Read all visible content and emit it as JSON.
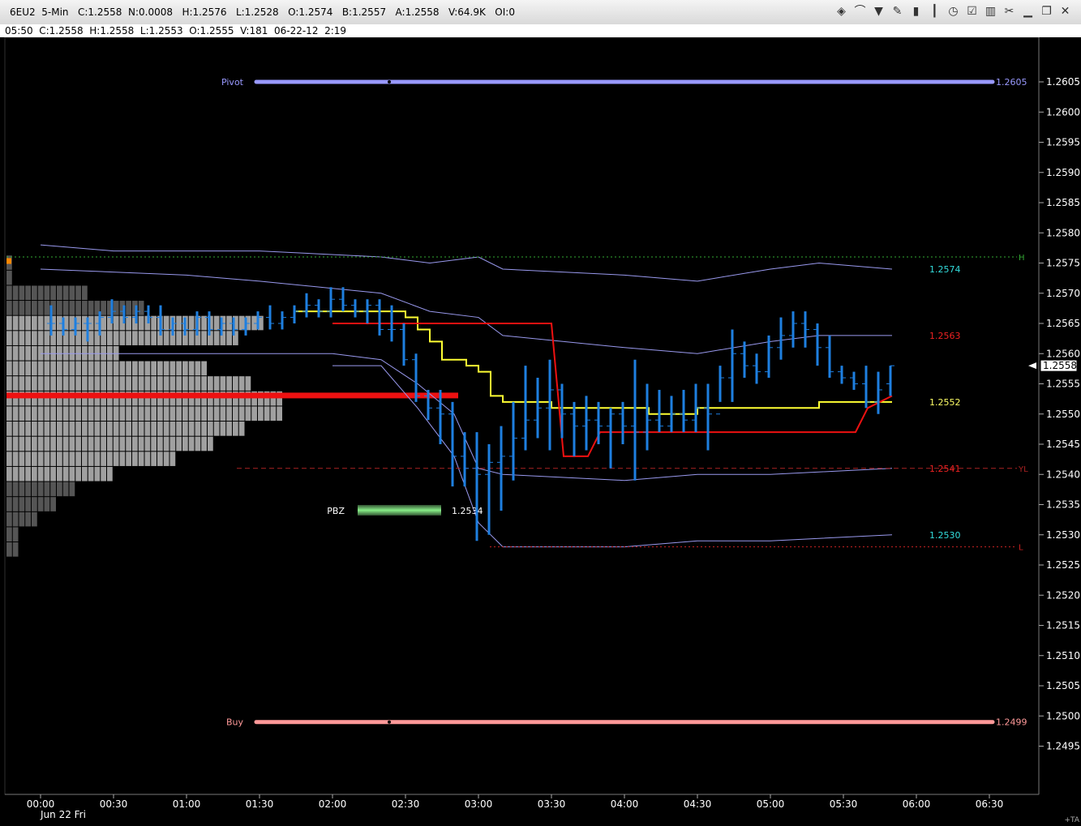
{
  "window": {
    "title": "6EU2  5-Min   C:1.2558  N:0.0008   H:1.2576   L:1.2528   O:1.2574   B:1.2557   A:1.2558   V:64.9K   OI:0",
    "info": "05:50  C:1.2558  H:1.2558  L:1.2553  O:1.2555  V:181  06-22-12  2:19",
    "toolbar": [
      "layers-icon",
      "rainbow-icon",
      "funnel-icon",
      "pencil-icon",
      "bars-icon",
      "candle-icon",
      "clock-icon",
      "checklist-icon",
      "trash-icon",
      "tool-icon",
      "minimize-icon",
      "restore-icon",
      "close-icon"
    ],
    "corner_label": "+TA"
  },
  "chart_data": {
    "type": "bar",
    "price_axis": {
      "range": [
        1.2491,
        1.2615
      ],
      "ticks": [
        "1.2605",
        "1.2600",
        "1.2595",
        "1.2590",
        "1.2585",
        "1.2580",
        "1.2575",
        "1.2570",
        "1.2565",
        "1.2560",
        "1.2555",
        "1.2550",
        "1.2545",
        "1.2540",
        "1.2535",
        "1.2530",
        "1.2525",
        "1.2520",
        "1.2515",
        "1.2510",
        "1.2505",
        "1.2500",
        "1.2495"
      ],
      "last_price_label": "1.2558",
      "last_price": 1.2558
    },
    "time_axis": {
      "ticks": [
        "00:00",
        "00:30",
        "01:00",
        "01:30",
        "02:00",
        "02:30",
        "03:00",
        "03:30",
        "04:00",
        "04:30",
        "05:00",
        "05:30",
        "06:00",
        "06:30"
      ],
      "date_label": "Jun 22 Fri"
    },
    "colors": {
      "bars": "#1e7fe0",
      "yellow": "#ffff33",
      "red": "#ee1111",
      "blue_bands": "#9999ee",
      "pivot": "#9999ff",
      "buy": "#ff9999",
      "profile_light": "#a0a0a0",
      "profile_dark": "#555555",
      "poc": "#ee1111",
      "pbz": "#88ee88"
    },
    "levels": [
      {
        "label": "Pivot",
        "value": 1.2605,
        "value_label": "1.2605",
        "style": "thick",
        "color": "#9999ff",
        "name_color": "#9999ff"
      },
      {
        "label": "Buy",
        "value": 1.2499,
        "value_label": "1.2499",
        "style": "thick",
        "color": "#ff9999",
        "name_color": "#ff9999"
      },
      {
        "label": "H",
        "value": 1.2576,
        "style": "dotted",
        "color": "#33aa33"
      },
      {
        "label": "YL",
        "value": 1.2541,
        "style": "dashed",
        "color": "#aa2222"
      },
      {
        "label": "L",
        "value": 1.2528,
        "style": "dotted",
        "color": "#cc2222"
      }
    ],
    "right_labels": [
      {
        "value": 1.2574,
        "text": "1.2574",
        "color": "#33dddd"
      },
      {
        "value": 1.2563,
        "text": "1.2563",
        "color": "#ee2222"
      },
      {
        "value": 1.2552,
        "text": "1.2552",
        "color": "#ffff66"
      },
      {
        "value": 1.2541,
        "text": "1.2541",
        "color": "#ee2222"
      },
      {
        "value": 1.253,
        "text": "1.2530",
        "color": "#33dddd"
      }
    ],
    "pbz": {
      "label": "PBZ",
      "value": 1.2534,
      "value_label": "1.2534"
    },
    "poc_price": 1.2553,
    "ohlc_bars": [
      [
        "00:05",
        1.2565,
        1.2568,
        1.2563,
        1.2565
      ],
      [
        "00:10",
        1.2565,
        1.2566,
        1.2563,
        1.2564
      ],
      [
        "00:15",
        1.2564,
        1.2566,
        1.2563,
        1.2565
      ],
      [
        "00:20",
        1.2565,
        1.2566,
        1.2562,
        1.2565
      ],
      [
        "00:25",
        1.2565,
        1.2567,
        1.2563,
        1.2566
      ],
      [
        "00:30",
        1.2566,
        1.2569,
        1.2565,
        1.2567
      ],
      [
        "00:35",
        1.2567,
        1.2568,
        1.2565,
        1.2566
      ],
      [
        "00:40",
        1.2566,
        1.2568,
        1.2565,
        1.2567
      ],
      [
        "00:45",
        1.2567,
        1.2568,
        1.2565,
        1.2566
      ],
      [
        "00:50",
        1.2566,
        1.2568,
        1.2563,
        1.2564
      ],
      [
        "00:55",
        1.2564,
        1.2566,
        1.2563,
        1.2565
      ],
      [
        "01:00",
        1.2565,
        1.2566,
        1.2563,
        1.2564
      ],
      [
        "01:05",
        1.2564,
        1.2567,
        1.2563,
        1.2566
      ],
      [
        "01:10",
        1.2566,
        1.2567,
        1.2563,
        1.2564
      ],
      [
        "01:15",
        1.2564,
        1.2566,
        1.2563,
        1.2565
      ],
      [
        "01:20",
        1.2565,
        1.2566,
        1.2563,
        1.2564
      ],
      [
        "01:25",
        1.2564,
        1.2566,
        1.2563,
        1.2565
      ],
      [
        "01:30",
        1.2565,
        1.2567,
        1.2564,
        1.2566
      ],
      [
        "01:35",
        1.2566,
        1.2568,
        1.2564,
        1.2565
      ],
      [
        "01:40",
        1.2565,
        1.2567,
        1.2564,
        1.2566
      ],
      [
        "01:45",
        1.2566,
        1.2568,
        1.2565,
        1.2567
      ],
      [
        "01:50",
        1.2567,
        1.257,
        1.2566,
        1.2568
      ],
      [
        "01:55",
        1.2568,
        1.2569,
        1.2566,
        1.2567
      ],
      [
        "02:00",
        1.2567,
        1.2571,
        1.2566,
        1.2569
      ],
      [
        "02:05",
        1.2569,
        1.2571,
        1.2567,
        1.2568
      ],
      [
        "02:10",
        1.2568,
        1.2569,
        1.2566,
        1.2567
      ],
      [
        "02:15",
        1.2567,
        1.2569,
        1.2565,
        1.2568
      ],
      [
        "02:20",
        1.2568,
        1.2569,
        1.2563,
        1.2564
      ],
      [
        "02:25",
        1.2564,
        1.2568,
        1.2562,
        1.2564
      ],
      [
        "02:30",
        1.2564,
        1.2565,
        1.2558,
        1.2559
      ],
      [
        "02:35",
        1.2559,
        1.256,
        1.2552,
        1.2553
      ],
      [
        "02:40",
        1.2553,
        1.2554,
        1.2549,
        1.2551
      ],
      [
        "02:45",
        1.2551,
        1.2554,
        1.2545,
        1.255
      ],
      [
        "02:50",
        1.255,
        1.2552,
        1.2538,
        1.2543
      ],
      [
        "02:55",
        1.2543,
        1.2547,
        1.2538,
        1.2541
      ],
      [
        "03:00",
        1.2541,
        1.2547,
        1.2529,
        1.254
      ],
      [
        "03:05",
        1.254,
        1.2545,
        1.253,
        1.2542
      ],
      [
        "03:10",
        1.2542,
        1.2548,
        1.2534,
        1.2543
      ],
      [
        "03:15",
        1.2543,
        1.2552,
        1.2539,
        1.2546
      ],
      [
        "03:20",
        1.2546,
        1.2558,
        1.2544,
        1.2549
      ],
      [
        "03:25",
        1.2549,
        1.2556,
        1.2546,
        1.2551
      ],
      [
        "03:30",
        1.2551,
        1.2559,
        1.2544,
        1.2554
      ],
      [
        "03:35",
        1.2554,
        1.2555,
        1.2546,
        1.255
      ],
      [
        "03:40",
        1.255,
        1.2552,
        1.2543,
        1.2548
      ],
      [
        "03:45",
        1.2548,
        1.2553,
        1.2544,
        1.2549
      ],
      [
        "03:50",
        1.2549,
        1.2552,
        1.2545,
        1.2548
      ],
      [
        "03:55",
        1.2548,
        1.2551,
        1.2541,
        1.255
      ],
      [
        "04:00",
        1.255,
        1.2552,
        1.2545,
        1.2548
      ],
      [
        "04:05",
        1.2548,
        1.2559,
        1.2539,
        1.2547
      ],
      [
        "04:10",
        1.2547,
        1.2555,
        1.2544,
        1.2549
      ],
      [
        "04:15",
        1.2549,
        1.2554,
        1.2547,
        1.2548
      ],
      [
        "04:20",
        1.2548,
        1.2553,
        1.2547,
        1.255
      ],
      [
        "04:25",
        1.255,
        1.2554,
        1.2547,
        1.2549
      ],
      [
        "04:30",
        1.2549,
        1.2555,
        1.2547,
        1.2551
      ],
      [
        "04:35",
        1.2551,
        1.2555,
        1.2544,
        1.255
      ],
      [
        "04:40",
        1.255,
        1.2558,
        1.2552,
        1.2556
      ],
      [
        "04:45",
        1.2556,
        1.2564,
        1.2552,
        1.256
      ],
      [
        "04:50",
        1.256,
        1.2562,
        1.2556,
        1.2558
      ],
      [
        "04:55",
        1.2558,
        1.256,
        1.2555,
        1.2557
      ],
      [
        "05:00",
        1.2557,
        1.2563,
        1.2556,
        1.2561
      ],
      [
        "05:05",
        1.2561,
        1.2566,
        1.2559,
        1.2563
      ],
      [
        "05:10",
        1.2563,
        1.2567,
        1.2561,
        1.2565
      ],
      [
        "05:15",
        1.2565,
        1.2567,
        1.2561,
        1.2564
      ],
      [
        "05:20",
        1.2564,
        1.2565,
        1.2558,
        1.2561
      ],
      [
        "05:25",
        1.2561,
        1.2563,
        1.2556,
        1.2557
      ],
      [
        "05:30",
        1.2557,
        1.2558,
        1.2555,
        1.2556
      ],
      [
        "05:35",
        1.2556,
        1.2557,
        1.2554,
        1.2555
      ],
      [
        "05:40",
        1.2555,
        1.2558,
        1.2551,
        1.2552
      ],
      [
        "05:45",
        1.2552,
        1.2557,
        1.255,
        1.2554
      ],
      [
        "05:50",
        1.2555,
        1.2558,
        1.2553,
        1.2558
      ]
    ],
    "profile": {
      "tick": 0.00025,
      "rows": [
        [
          1.2575,
          1
        ],
        [
          1.25725,
          1
        ],
        [
          1.257,
          13
        ],
        [
          1.25675,
          22
        ],
        [
          1.2565,
          41
        ],
        [
          1.25625,
          37
        ],
        [
          1.256,
          18
        ],
        [
          1.25575,
          32
        ],
        [
          1.2555,
          39
        ],
        [
          1.25525,
          44
        ],
        [
          1.255,
          44
        ],
        [
          1.25475,
          38
        ],
        [
          1.2545,
          33
        ],
        [
          1.25425,
          27
        ],
        [
          1.254,
          17
        ],
        [
          1.25375,
          11
        ],
        [
          1.2535,
          8
        ],
        [
          1.25325,
          5
        ],
        [
          1.253,
          2
        ],
        [
          1.25275,
          2
        ]
      ]
    }
  }
}
